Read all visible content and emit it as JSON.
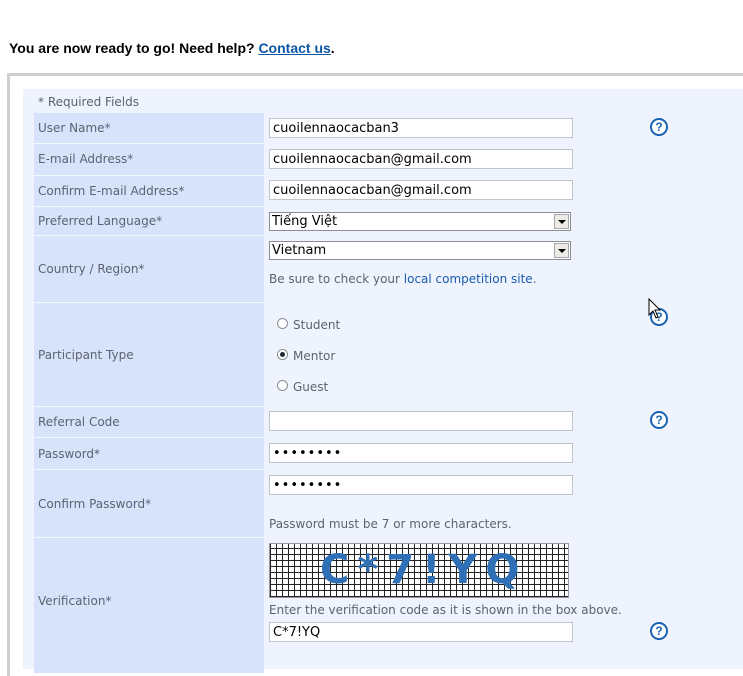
{
  "intro": {
    "text": "You are now ready to go! Need help? ",
    "link": "Contact us",
    "suffix": "."
  },
  "required_note": "* Required Fields",
  "fields": {
    "username": {
      "label": "User Name*",
      "value": "cuoilennaocacban3"
    },
    "email": {
      "label": "E-mail Address*",
      "value": "cuoilennaocacban@gmail.com"
    },
    "confirm_email": {
      "label": "Confirm E-mail Address*",
      "value": "cuoilennaocacban@gmail.com"
    },
    "language": {
      "label": "Preferred Language*",
      "value": "Tiếng Việt"
    },
    "country": {
      "label": "Country / Region*",
      "value": "Vietnam",
      "hint_prefix": "Be sure to check your ",
      "hint_link": "local competition site",
      "hint_suffix": "."
    },
    "participant": {
      "label": "Participant Type",
      "options": [
        "Student",
        "Mentor",
        "Guest"
      ],
      "selected": "Mentor"
    },
    "referral": {
      "label": "Referral Code",
      "value": ""
    },
    "password": {
      "label": "Password*",
      "value": "••••••••"
    },
    "confirm_password": {
      "label": "Confirm Password*",
      "value": "••••••••",
      "hint": "Password must be 7 or more characters."
    },
    "verification": {
      "label": "Verification*",
      "captcha_text": "C*7!YQ",
      "hint": "Enter the verification code as it is shown in the box above.",
      "value": "C*7!YQ"
    }
  },
  "help_icon_glyph": "?",
  "colors": {
    "label_bg": "#d6e3fb",
    "panel_bg": "#eef3fd",
    "link": "#0b57a5",
    "help": "#1963b5"
  }
}
